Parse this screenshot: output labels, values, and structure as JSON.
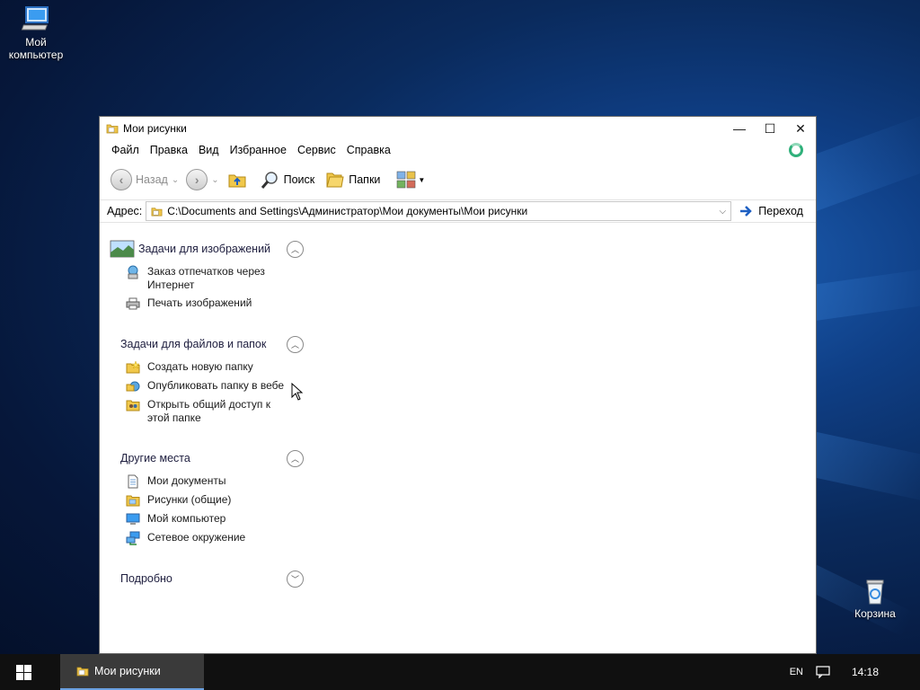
{
  "desktop": {
    "icons": [
      {
        "label": "Мой\nкомпьютер"
      },
      {
        "label": "Корзина"
      }
    ]
  },
  "window": {
    "title": "Мои рисунки",
    "controls": {
      "minimize": "—",
      "maximize": "☐",
      "close": "✕"
    },
    "menu": [
      "Файл",
      "Правка",
      "Вид",
      "Избранное",
      "Сервис",
      "Справка"
    ],
    "toolbar": {
      "back_label": "Назад",
      "search_label": "Поиск",
      "folders_label": "Папки"
    },
    "address": {
      "label": "Адрес:",
      "path": "C:\\Documents and Settings\\Администратор\\Мои документы\\Мои рисунки",
      "go_label": "Переход"
    },
    "taskpane": {
      "groups": [
        {
          "title": "Задачи для изображений",
          "items": [
            "Заказ отпечатков через Интернет",
            "Печать изображений"
          ]
        },
        {
          "title": "Задачи для файлов и папок",
          "items": [
            "Создать новую папку",
            "Опубликовать папку в вебе",
            "Открыть общий доступ к этой папке"
          ]
        },
        {
          "title": "Другие места",
          "items": [
            "Мои документы",
            "Рисунки (общие)",
            "Мой компьютер",
            "Сетевое окружение"
          ]
        },
        {
          "title": "Подробно",
          "items": []
        }
      ]
    }
  },
  "taskbar": {
    "task_label": "Мои рисунки",
    "lang": "EN",
    "clock": "14:18"
  }
}
